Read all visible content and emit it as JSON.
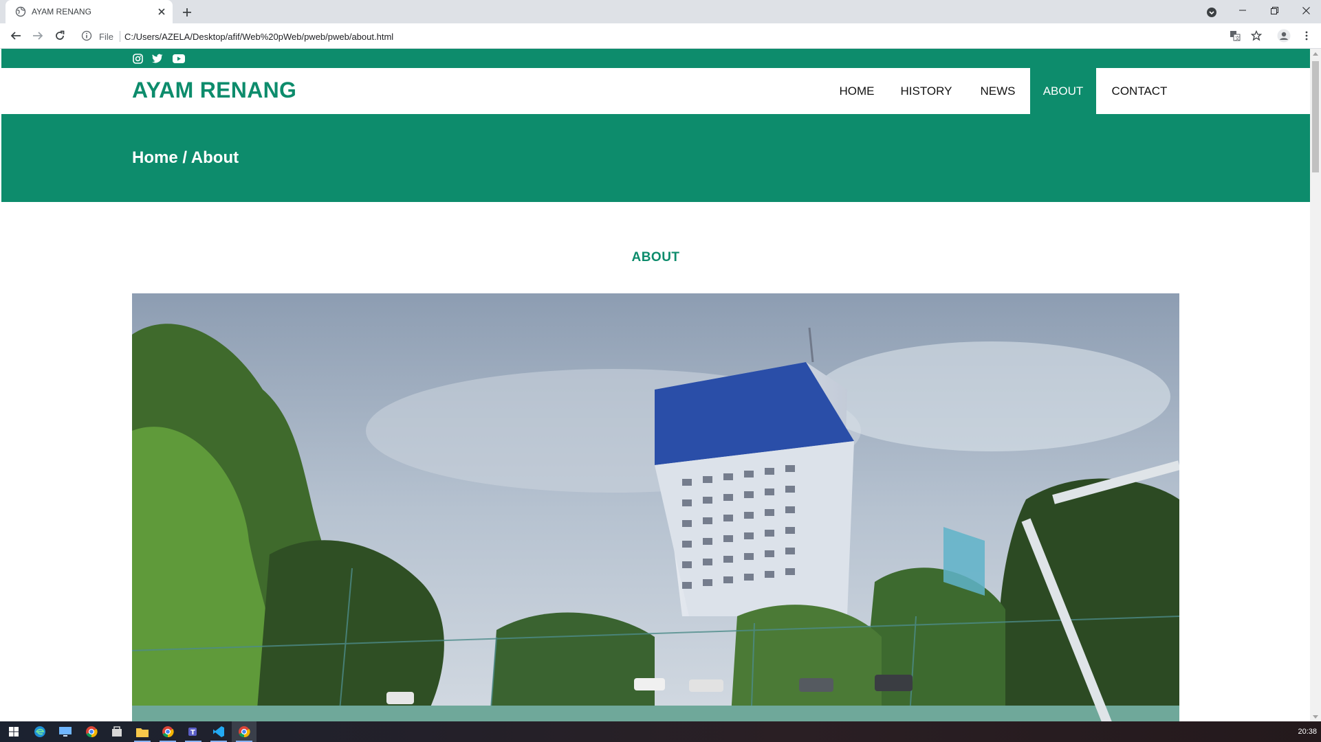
{
  "browser": {
    "tab_title": "AYAM RENANG",
    "omnibox_scheme_label": "File",
    "url": "C:/Users/AZELA/Desktop/afif/Web%20pWeb/pweb/pweb/about.html"
  },
  "site": {
    "brand": "AYAM RENANG",
    "social_icons": [
      "instagram-icon",
      "twitter-icon",
      "youtube-icon"
    ],
    "nav": [
      {
        "label": "HOME",
        "active": false
      },
      {
        "label": "HISTORY",
        "active": false
      },
      {
        "label": "NEWS",
        "active": false
      },
      {
        "label": "ABOUT",
        "active": true
      },
      {
        "label": "CONTACT",
        "active": false
      }
    ],
    "breadcrumb": "Home / About",
    "section_title": "ABOUT"
  },
  "taskbar": {
    "time": "20:38",
    "apps": [
      "start-icon",
      "edge-icon",
      "desktop-icon",
      "chrome-icon",
      "store-icon",
      "file-explorer-icon",
      "chrome-icon",
      "teams-icon",
      "vscode-icon",
      "chrome-icon"
    ]
  },
  "colors": {
    "brand_green": "#0d8c6c",
    "tabstrip": "#dee1e6"
  }
}
